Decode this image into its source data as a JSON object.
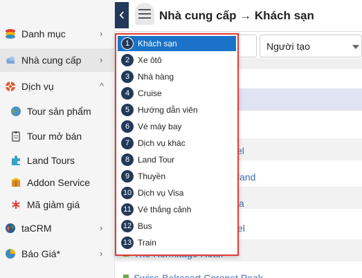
{
  "header": {
    "back_glyph": "‹",
    "title": "Nhà cung cấp → Khách sạn"
  },
  "filters": {
    "creator_label": "Người tạo"
  },
  "sidebar": {
    "items": [
      {
        "label": "Danh mục",
        "chevron": "›",
        "icon": "stack-icon"
      },
      {
        "label": "Nhà cung cấp",
        "chevron": "›",
        "icon": "cloud-icon"
      },
      {
        "label": "Dịch vụ",
        "chevron": "^",
        "icon": "lifebuoy-icon"
      },
      {
        "label": "taCRM",
        "chevron": "›",
        "icon": "globe-icon"
      },
      {
        "label": "Báo Giá*",
        "chevron": "›",
        "icon": "pie-icon"
      }
    ],
    "sub_items": [
      {
        "label": "Tour sản phẩm",
        "icon": "globe-icon"
      },
      {
        "label": "Tour mở bán",
        "icon": "clipboard-icon"
      },
      {
        "label": "Land Tours",
        "icon": "puzzle-icon"
      },
      {
        "label": "Addon Service",
        "icon": "box-icon"
      },
      {
        "label": "Mã giảm giá",
        "icon": "asterisk-icon"
      }
    ]
  },
  "background_list": {
    "fragments": [
      "el",
      "land",
      "a",
      "el",
      "The Hermitage Hotel",
      "Swiss-Belresort Coronet Peak"
    ]
  },
  "dropdown": {
    "items": [
      {
        "num": "1",
        "label": "Khách sạn",
        "selected": true
      },
      {
        "num": "2",
        "label": "Xe ôtô"
      },
      {
        "num": "3",
        "label": "Nhà hàng"
      },
      {
        "num": "4",
        "label": "Cruise"
      },
      {
        "num": "5",
        "label": "Hướng dẫn viên"
      },
      {
        "num": "6",
        "label": "Vé máy bay"
      },
      {
        "num": "7",
        "label": "Dịch vụ khác"
      },
      {
        "num": "8",
        "label": "Land Tour"
      },
      {
        "num": "9",
        "label": "Thuyền"
      },
      {
        "num": "10",
        "label": "Dịch vụ Visa"
      },
      {
        "num": "11",
        "label": "Vé thắng cảnh"
      },
      {
        "num": "12",
        "label": "Bus"
      },
      {
        "num": "13",
        "label": "Train"
      }
    ]
  },
  "colors": {
    "accent": "#1a73c8",
    "navy": "#23395b",
    "highlight_border": "#e53935",
    "link": "#3a6fb0"
  }
}
